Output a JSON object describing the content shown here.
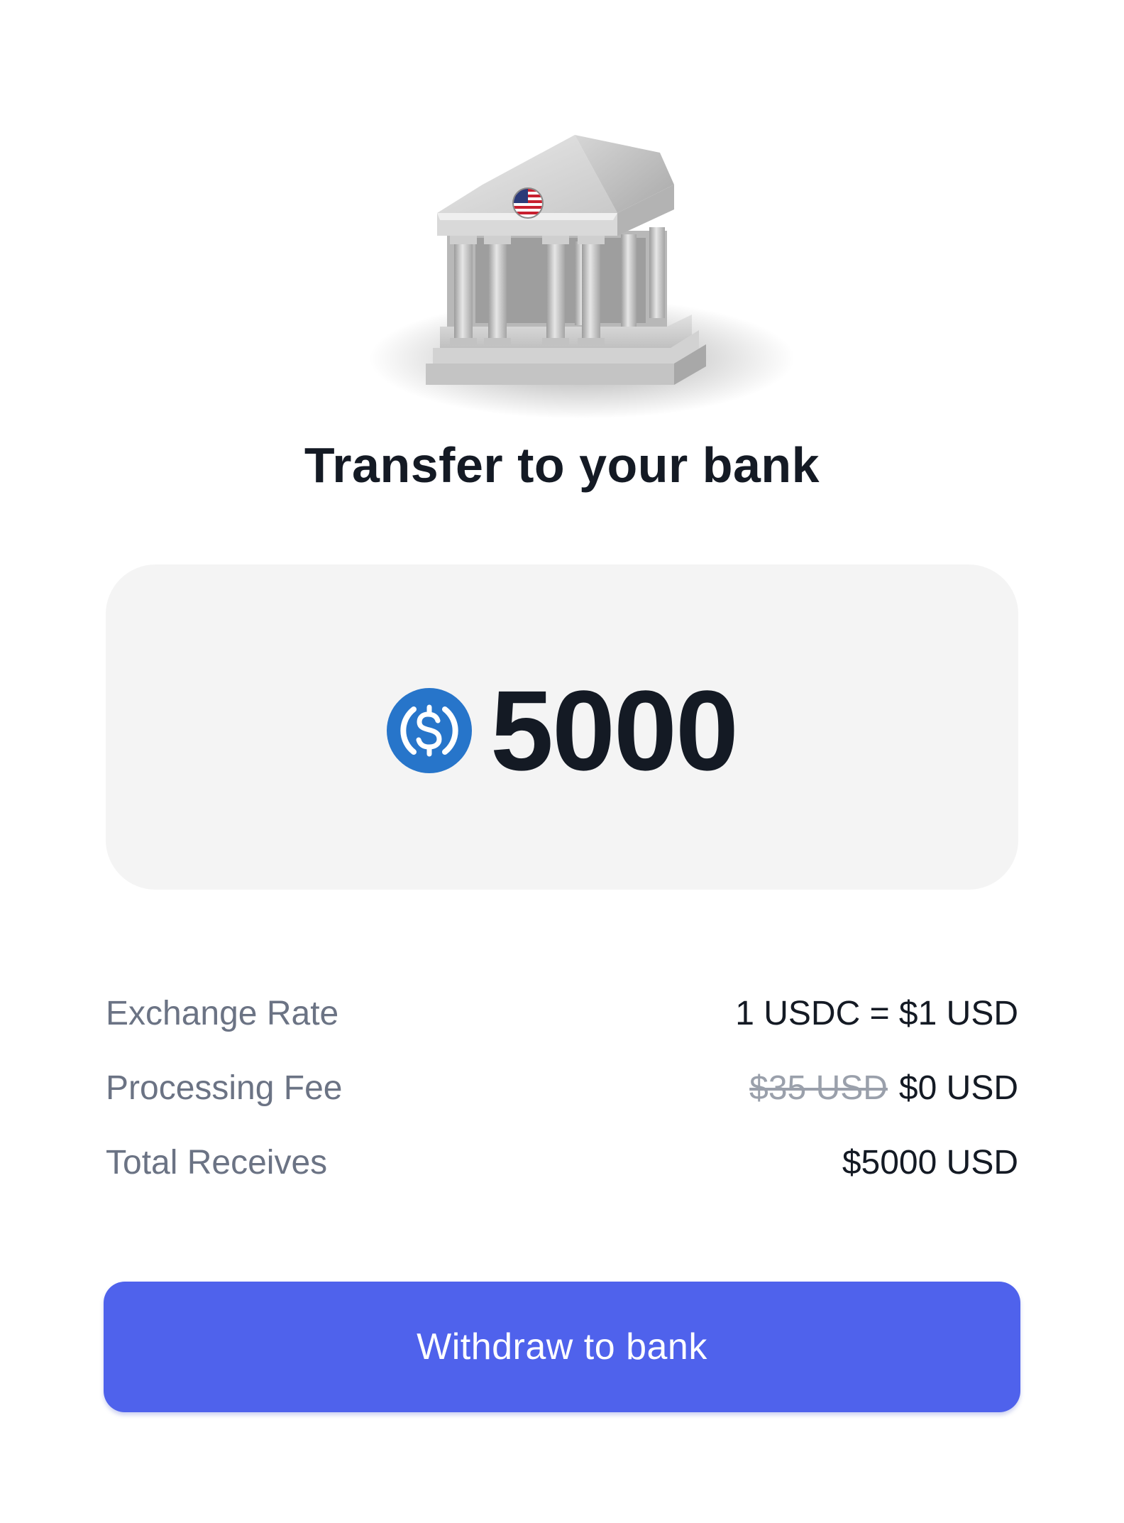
{
  "header": {
    "illustration": "bank-building-with-us-flag",
    "title": "Transfer to your bank"
  },
  "amount": {
    "currency_icon": "usdc-icon",
    "value": "5000"
  },
  "details": [
    {
      "label": "Exchange Rate",
      "value": "1 USDC = $1 USD"
    },
    {
      "label": "Processing Fee",
      "original_value": "$35 USD",
      "value": "$0 USD"
    },
    {
      "label": "Total Receives",
      "value": "$5000 USD"
    }
  ],
  "actions": {
    "withdraw_label": "Withdraw to bank"
  },
  "colors": {
    "primary": "#4f62ec",
    "usdc_blue": "#2775ca",
    "text": "#141a24",
    "muted": "#6b7384",
    "card_bg": "#f4f4f4"
  }
}
